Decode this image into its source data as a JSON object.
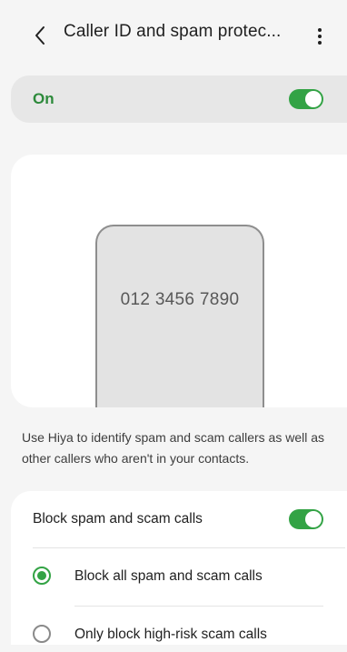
{
  "header": {
    "back_icon": "chevron-left-icon",
    "title": "Caller ID and spam protec...",
    "more_icon": "more-vertical-icon"
  },
  "master_toggle": {
    "label": "On",
    "state": true
  },
  "preview": {
    "phone_number": "012 3456 7890"
  },
  "description": "Use Hiya to identify spam and scam callers as well as other callers who aren't in your contacts.",
  "settings": {
    "block_spam": {
      "label": "Block spam and scam calls",
      "state": true
    },
    "options": [
      {
        "label": "Block all spam and scam calls",
        "selected": true
      },
      {
        "label": "Only block high-risk scam calls",
        "selected": false
      }
    ]
  },
  "colors": {
    "accent": "#33a345",
    "on_text": "#2d8a3b",
    "background": "#f5f5f5"
  }
}
